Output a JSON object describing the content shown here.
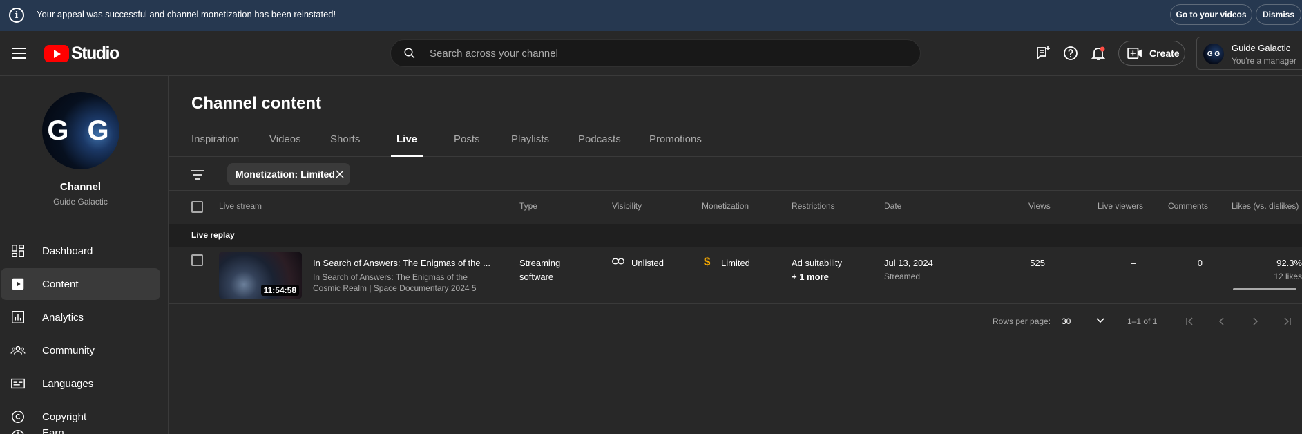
{
  "banner": {
    "message": "Your appeal was successful and channel monetization has been reinstated!",
    "go_button": "Go to your videos",
    "dismiss_button": "Dismiss"
  },
  "header": {
    "logo_text": "Studio",
    "search_placeholder": "Search across your channel",
    "create_label": "Create",
    "account_name": "Guide Galactic",
    "account_role": "You're a manager",
    "avatar_initials": "G G"
  },
  "sidebar": {
    "avatar_initials": "G G",
    "channel_label": "Channel",
    "channel_name": "Guide Galactic",
    "items": [
      {
        "label": "Dashboard",
        "icon": "dashboard-icon"
      },
      {
        "label": "Content",
        "icon": "content-icon",
        "active": true
      },
      {
        "label": "Analytics",
        "icon": "analytics-icon"
      },
      {
        "label": "Community",
        "icon": "community-icon"
      },
      {
        "label": "Languages",
        "icon": "languages-icon"
      },
      {
        "label": "Copyright",
        "icon": "copyright-icon"
      },
      {
        "label": "Earn",
        "icon": "earn-icon"
      }
    ]
  },
  "main": {
    "title": "Channel content",
    "tabs": [
      "Inspiration",
      "Videos",
      "Shorts",
      "Live",
      "Posts",
      "Playlists",
      "Podcasts",
      "Promotions"
    ],
    "active_tab": "Live",
    "filter_chip": "Monetization: Limited",
    "columns": [
      "Live stream",
      "Type",
      "Visibility",
      "Monetization",
      "Restrictions",
      "Date",
      "Views",
      "Live viewers",
      "Comments",
      "Likes (vs. dislikes)"
    ],
    "group_label": "Live replay",
    "rows": [
      {
        "duration": "11:54:58",
        "title": "In Search of Answers: The Enigmas of the ...",
        "description": "In Search of Answers: The Enigmas of the Cosmic Realm | Space Documentary 2024 5",
        "type_line1": "Streaming",
        "type_line2": "software",
        "visibility": "Unlisted",
        "monetization": "Limited",
        "restrictions_line1": "Ad suitability",
        "restrictions_line2": "+ 1 more",
        "date": "Jul 13, 2024",
        "date_sub": "Streamed",
        "views": "525",
        "live_viewers": "–",
        "comments": "0",
        "likes_pct": "92.3%",
        "likes_count": "12 likes"
      }
    ],
    "pager": {
      "rows_label": "Rows per page:",
      "rows_value": "30",
      "range": "1–1 of 1"
    }
  },
  "colors": {
    "banner_bg": "#263850",
    "bg": "#282828",
    "monetization_icon": "#f9ab00",
    "notification_dot": "#ff4e45",
    "yt_red": "#ff0000"
  }
}
